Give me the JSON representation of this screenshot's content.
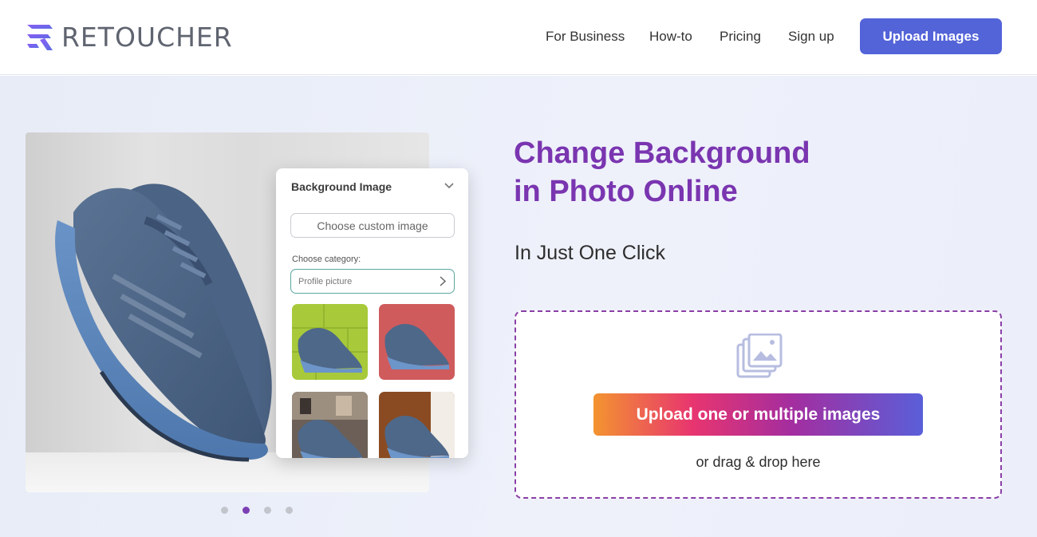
{
  "header": {
    "logo_text": "RETOUCHER",
    "nav": [
      {
        "label": "For Business"
      },
      {
        "label": "How-to"
      },
      {
        "label": "Pricing"
      },
      {
        "label": "Sign up"
      }
    ],
    "upload_button": "Upload Images"
  },
  "preview": {
    "panel_title": "Background Image",
    "custom_image_button": "Choose custom image",
    "category_label": "Choose category:",
    "category_value": "Profile picture",
    "carousel_active_index": 2,
    "carousel_total": 4
  },
  "hero": {
    "title_line1": "Change Background",
    "title_line2": "in Photo Online",
    "subtitle": "In Just One Click",
    "upload_button": "Upload one or multiple images",
    "drag_text": "or drag & drop here"
  },
  "colors": {
    "brand_purple": "#7a35b0",
    "primary_button": "#5363d8",
    "dropzone_border": "#8a3ea6"
  }
}
